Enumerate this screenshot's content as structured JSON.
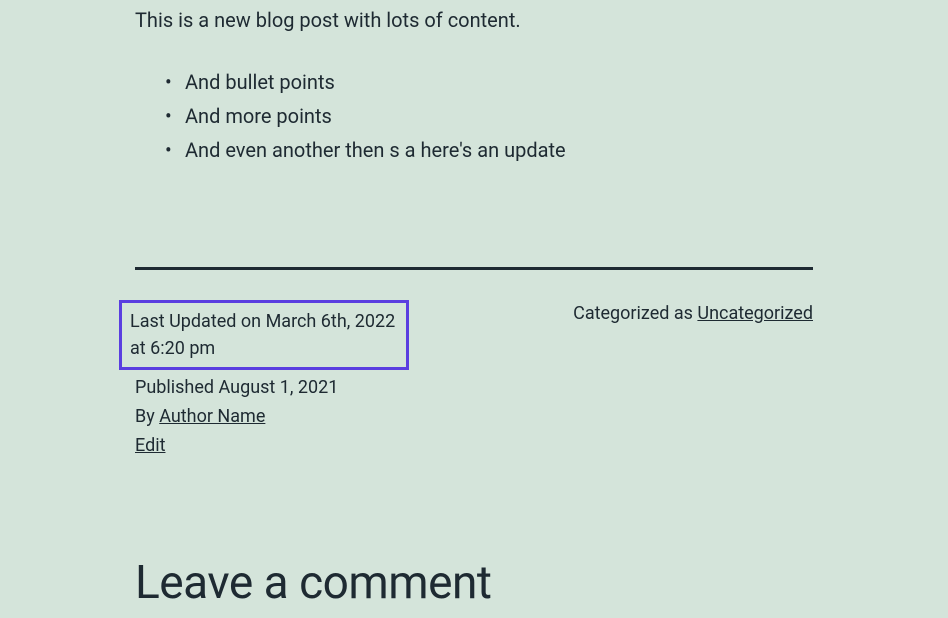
{
  "post": {
    "intro": "This is a new blog post with lots of content.",
    "bullets": [
      "And bullet points",
      "And more points",
      "And even another then s a here's an update"
    ]
  },
  "meta": {
    "last_updated": "Last Updated on March 6th, 2022 at 6:20 pm",
    "published_prefix": "Published ",
    "published_date": "August 1, 2021",
    "by_prefix": "By ",
    "author_name": "Author Name",
    "edit_label": "Edit",
    "categorized_prefix": "Categorized as ",
    "category": "Uncategorized"
  },
  "comments": {
    "heading": "Leave a comment"
  }
}
